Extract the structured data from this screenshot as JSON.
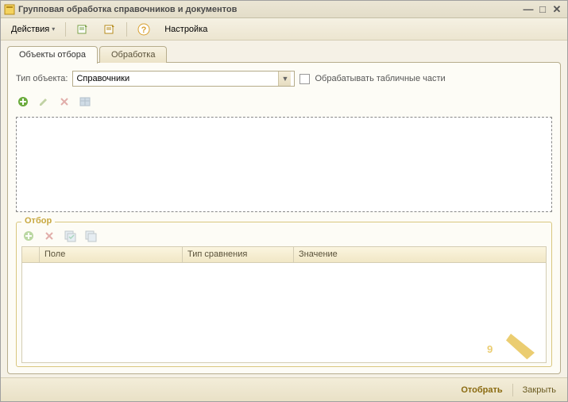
{
  "window": {
    "title": "Групповая обработка справочников и документов"
  },
  "toolbar": {
    "actions": "Действия",
    "settings": "Настройка"
  },
  "tabs": {
    "t1": "Объекты отбора",
    "t2": "Обработка"
  },
  "form": {
    "type_label": "Тип объекта:",
    "type_value": "Справочники",
    "process_tabular": "Обрабатывать табличные части"
  },
  "filter": {
    "legend": "Отбор",
    "col_field": "Поле",
    "col_compare": "Тип сравнения",
    "col_value": "Значение"
  },
  "footer": {
    "select": "Отобрать",
    "close": "Закрыть"
  }
}
